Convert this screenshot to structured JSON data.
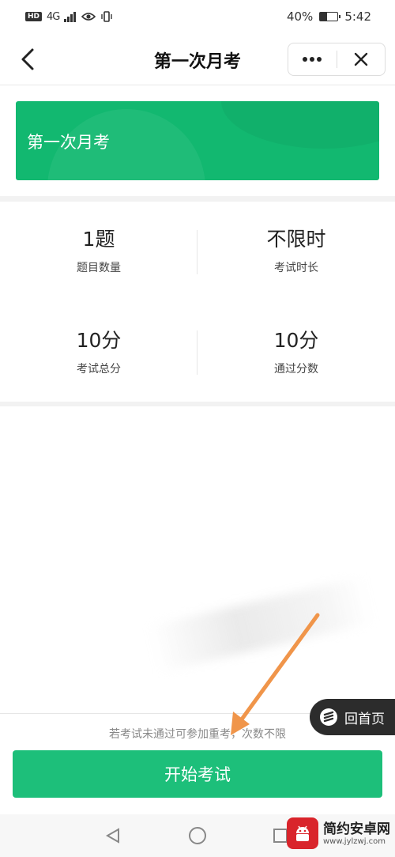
{
  "status_bar": {
    "hd": "HD",
    "network": "4G",
    "battery": "40%",
    "battery_level": 0.4,
    "time": "5:42"
  },
  "nav": {
    "title": "第一次月考",
    "more_icon": "more-dots-icon",
    "close_icon": "close-icon",
    "back_icon": "chevron-left-icon"
  },
  "banner": {
    "title": "第一次月考",
    "color": "#12b870"
  },
  "stats": [
    {
      "value": "1题",
      "label": "题目数量"
    },
    {
      "value": "不限时",
      "label": "考试时长"
    },
    {
      "value": "10分",
      "label": "考试总分"
    },
    {
      "value": "10分",
      "label": "通过分数"
    }
  ],
  "footer": {
    "note": "若考试未通过可参加重考，次数不限",
    "start_button": "开始考试",
    "button_color": "#1dbf7a"
  },
  "floating": {
    "home_label": "回首页"
  },
  "watermark": {
    "name": "简约安卓网",
    "url": "www.jylzwj.com"
  },
  "annotation": {
    "arrow_color": "#f0954a"
  }
}
